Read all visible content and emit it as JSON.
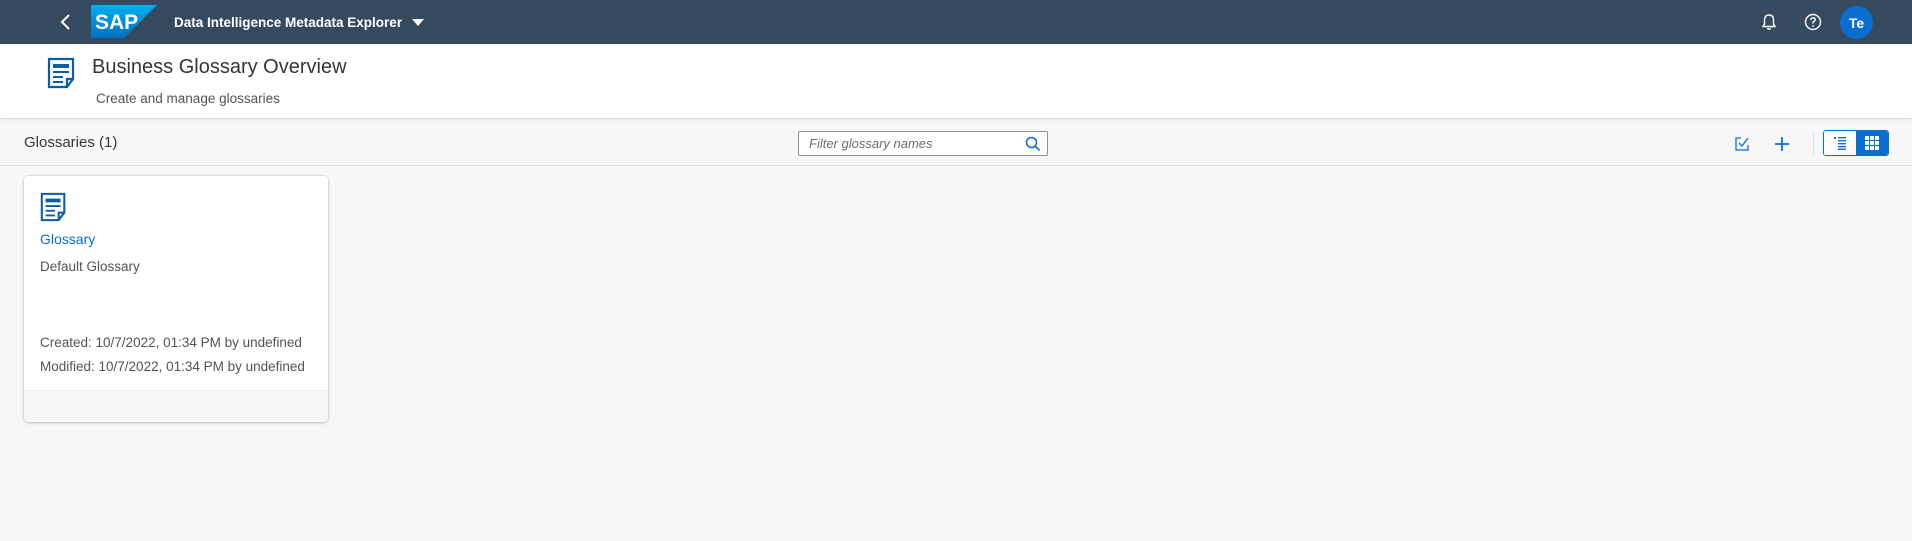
{
  "shell": {
    "product_title": "Data Intelligence Metadata Explorer",
    "logo_text": "SAP",
    "avatar_initials": "Te",
    "colors": {
      "shellbar": "#354a5f",
      "accent": "#0a6ed1"
    },
    "icons": [
      "back-icon",
      "bell-icon",
      "help-icon"
    ]
  },
  "header": {
    "title": "Business Glossary Overview",
    "subtitle": "Create and manage glossaries",
    "icon": "document-icon"
  },
  "toolbar": {
    "title": "Glossaries (1)",
    "search_placeholder": "Filter glossary names",
    "search_value": "",
    "actions": [
      "import-icon",
      "add-icon"
    ],
    "view_toggle": {
      "options": [
        "list-view-icon",
        "grid-view-icon"
      ],
      "selected": "grid-view-icon"
    }
  },
  "cards": [
    {
      "title": "Glossary",
      "description": "Default Glossary",
      "created": "Created: 10/7/2022, 01:34 PM by undefined",
      "modified": "Modified: 10/7/2022, 01:34 PM by undefined"
    }
  ]
}
